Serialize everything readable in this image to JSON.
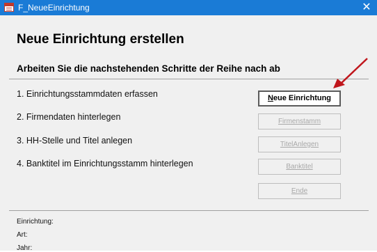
{
  "window": {
    "title": "F_NeueEinrichtung",
    "close_glyph": "✕"
  },
  "form": {
    "heading": "Neue Einrichtung erstellen",
    "subheading": "Arbeiten Sie die nachstehenden Schritte der Reihe nach ab",
    "steps": [
      "1. Einrichtungsstammdaten erfassen",
      "2. Firmendaten hinterlegen",
      "3. HH-Stelle und Titel anlegen",
      "4. Banktitel im Einrichtungsstamm hinterlegen"
    ],
    "buttons": {
      "neue_einrichtung_accel": "N",
      "neue_einrichtung_rest": "eue Einrichtung",
      "firmenstamm": "Firmenstamm",
      "titel_anlegen": "TitelAnlegen",
      "banktitel": "Banktitel",
      "ende": "Ende"
    },
    "info_labels": {
      "einrichtung": "Einrichtung:",
      "art": "Art:",
      "jahr": "Jahr:"
    }
  },
  "colors": {
    "titlebar": "#1a7bd6",
    "arrow": "#c0161c"
  },
  "icons": {
    "app": "access-form-icon",
    "close": "close-icon"
  }
}
